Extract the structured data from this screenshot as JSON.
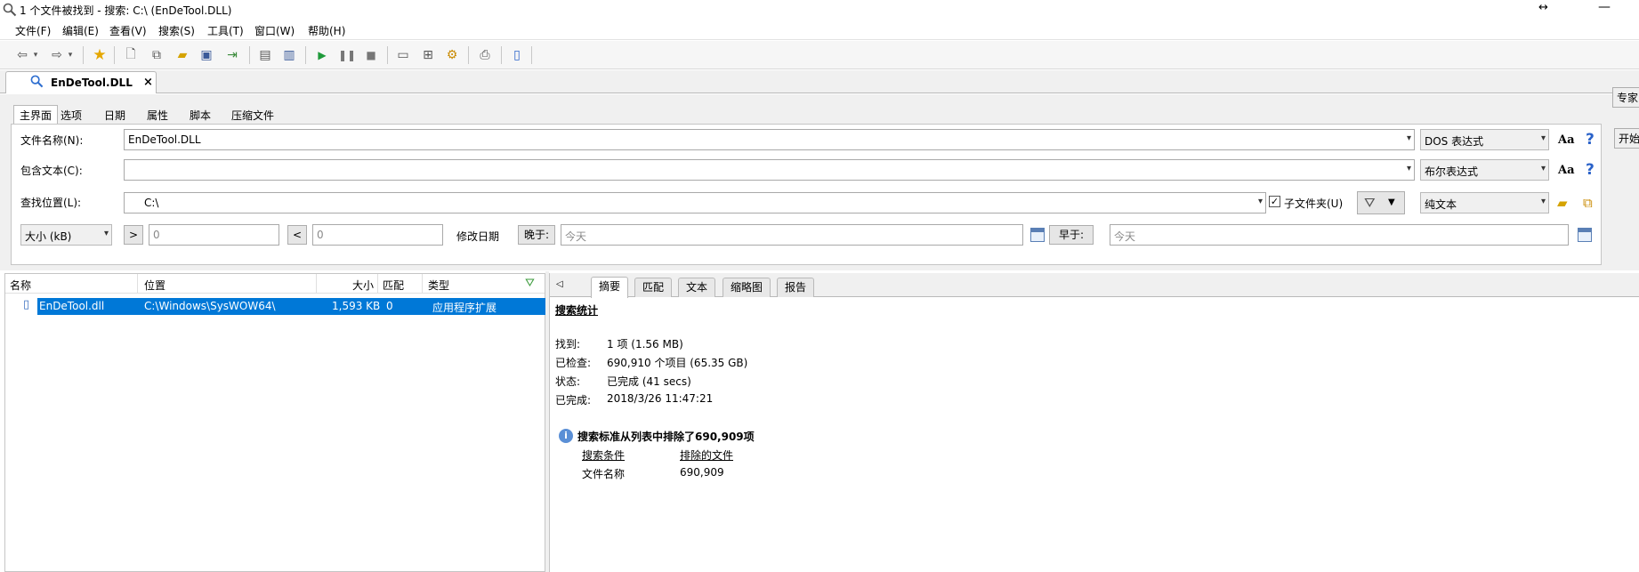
{
  "window": {
    "title": "1 个文件被找到 - 搜索: C:\\ (EnDeTool.DLL)",
    "resize_glyph": "↔",
    "min_glyph": "—"
  },
  "menu": [
    "文件(F)",
    "编辑(E)",
    "查看(V)",
    "搜索(S)",
    "工具(T)",
    "窗口(W)",
    "帮助(H)"
  ],
  "doc_tab": {
    "label": "EnDeTool.DLL",
    "close": "×"
  },
  "criteria_tabs": [
    "主界面",
    "选项",
    "日期",
    "属性",
    "脚本",
    "压缩文件"
  ],
  "form": {
    "filename_label": "文件名称(N):",
    "filename_value": "EnDeTool.DLL",
    "filename_mode": "DOS 表达式",
    "contains_label": "包含文本(C):",
    "contains_value": "",
    "contains_mode": "布尔表达式",
    "location_label": "查找位置(L):",
    "location_value": "C:\\",
    "subfolders_label": "子文件夹(U)",
    "subfolders_checked": "✓",
    "location_mode": "纯文本",
    "size_select": "大小 (kB)",
    "gt_btn": ">",
    "gt_value": "0",
    "lt_btn": "<",
    "lt_value": "0",
    "modified_label": "修改日期",
    "after_btn": "晚于:",
    "after_value": "今天",
    "before_btn": "早于:",
    "before_value": "今天",
    "aa": "Aa",
    "help": "?"
  },
  "side_buttons": [
    "专家",
    "开始"
  ],
  "columns": [
    "名称",
    "位置",
    "大小",
    "匹配",
    "类型"
  ],
  "rows": [
    {
      "name": "EnDeTool.dll",
      "location": "C:\\Windows\\SysWOW64\\",
      "size": "1,593 KB",
      "match": "0",
      "type": "应用程序扩展"
    }
  ],
  "result_tabs": [
    "摘要",
    "匹配",
    "文本",
    "缩略图",
    "报告"
  ],
  "summary": {
    "heading": "搜索统计",
    "found_label": "找到:",
    "found_value": "1 项 (1.56 MB)",
    "checked_label": "已检查:",
    "checked_value": "690,910 个项目 (65.35 GB)",
    "status_label": "状态:",
    "status_value": "已完成 (41 secs)",
    "completed_label": "已完成:",
    "completed_value": "2018/3/26 11:47:21",
    "excluded_heading": "搜索标准从列表中排除了690,909项",
    "col_criteria": "搜索条件",
    "col_excluded": "排除的文件",
    "criteria_row": "文件名称",
    "excluded_row": "690,909"
  },
  "colors": {
    "selection": "#0078d7",
    "accent": "#2a62c9"
  }
}
